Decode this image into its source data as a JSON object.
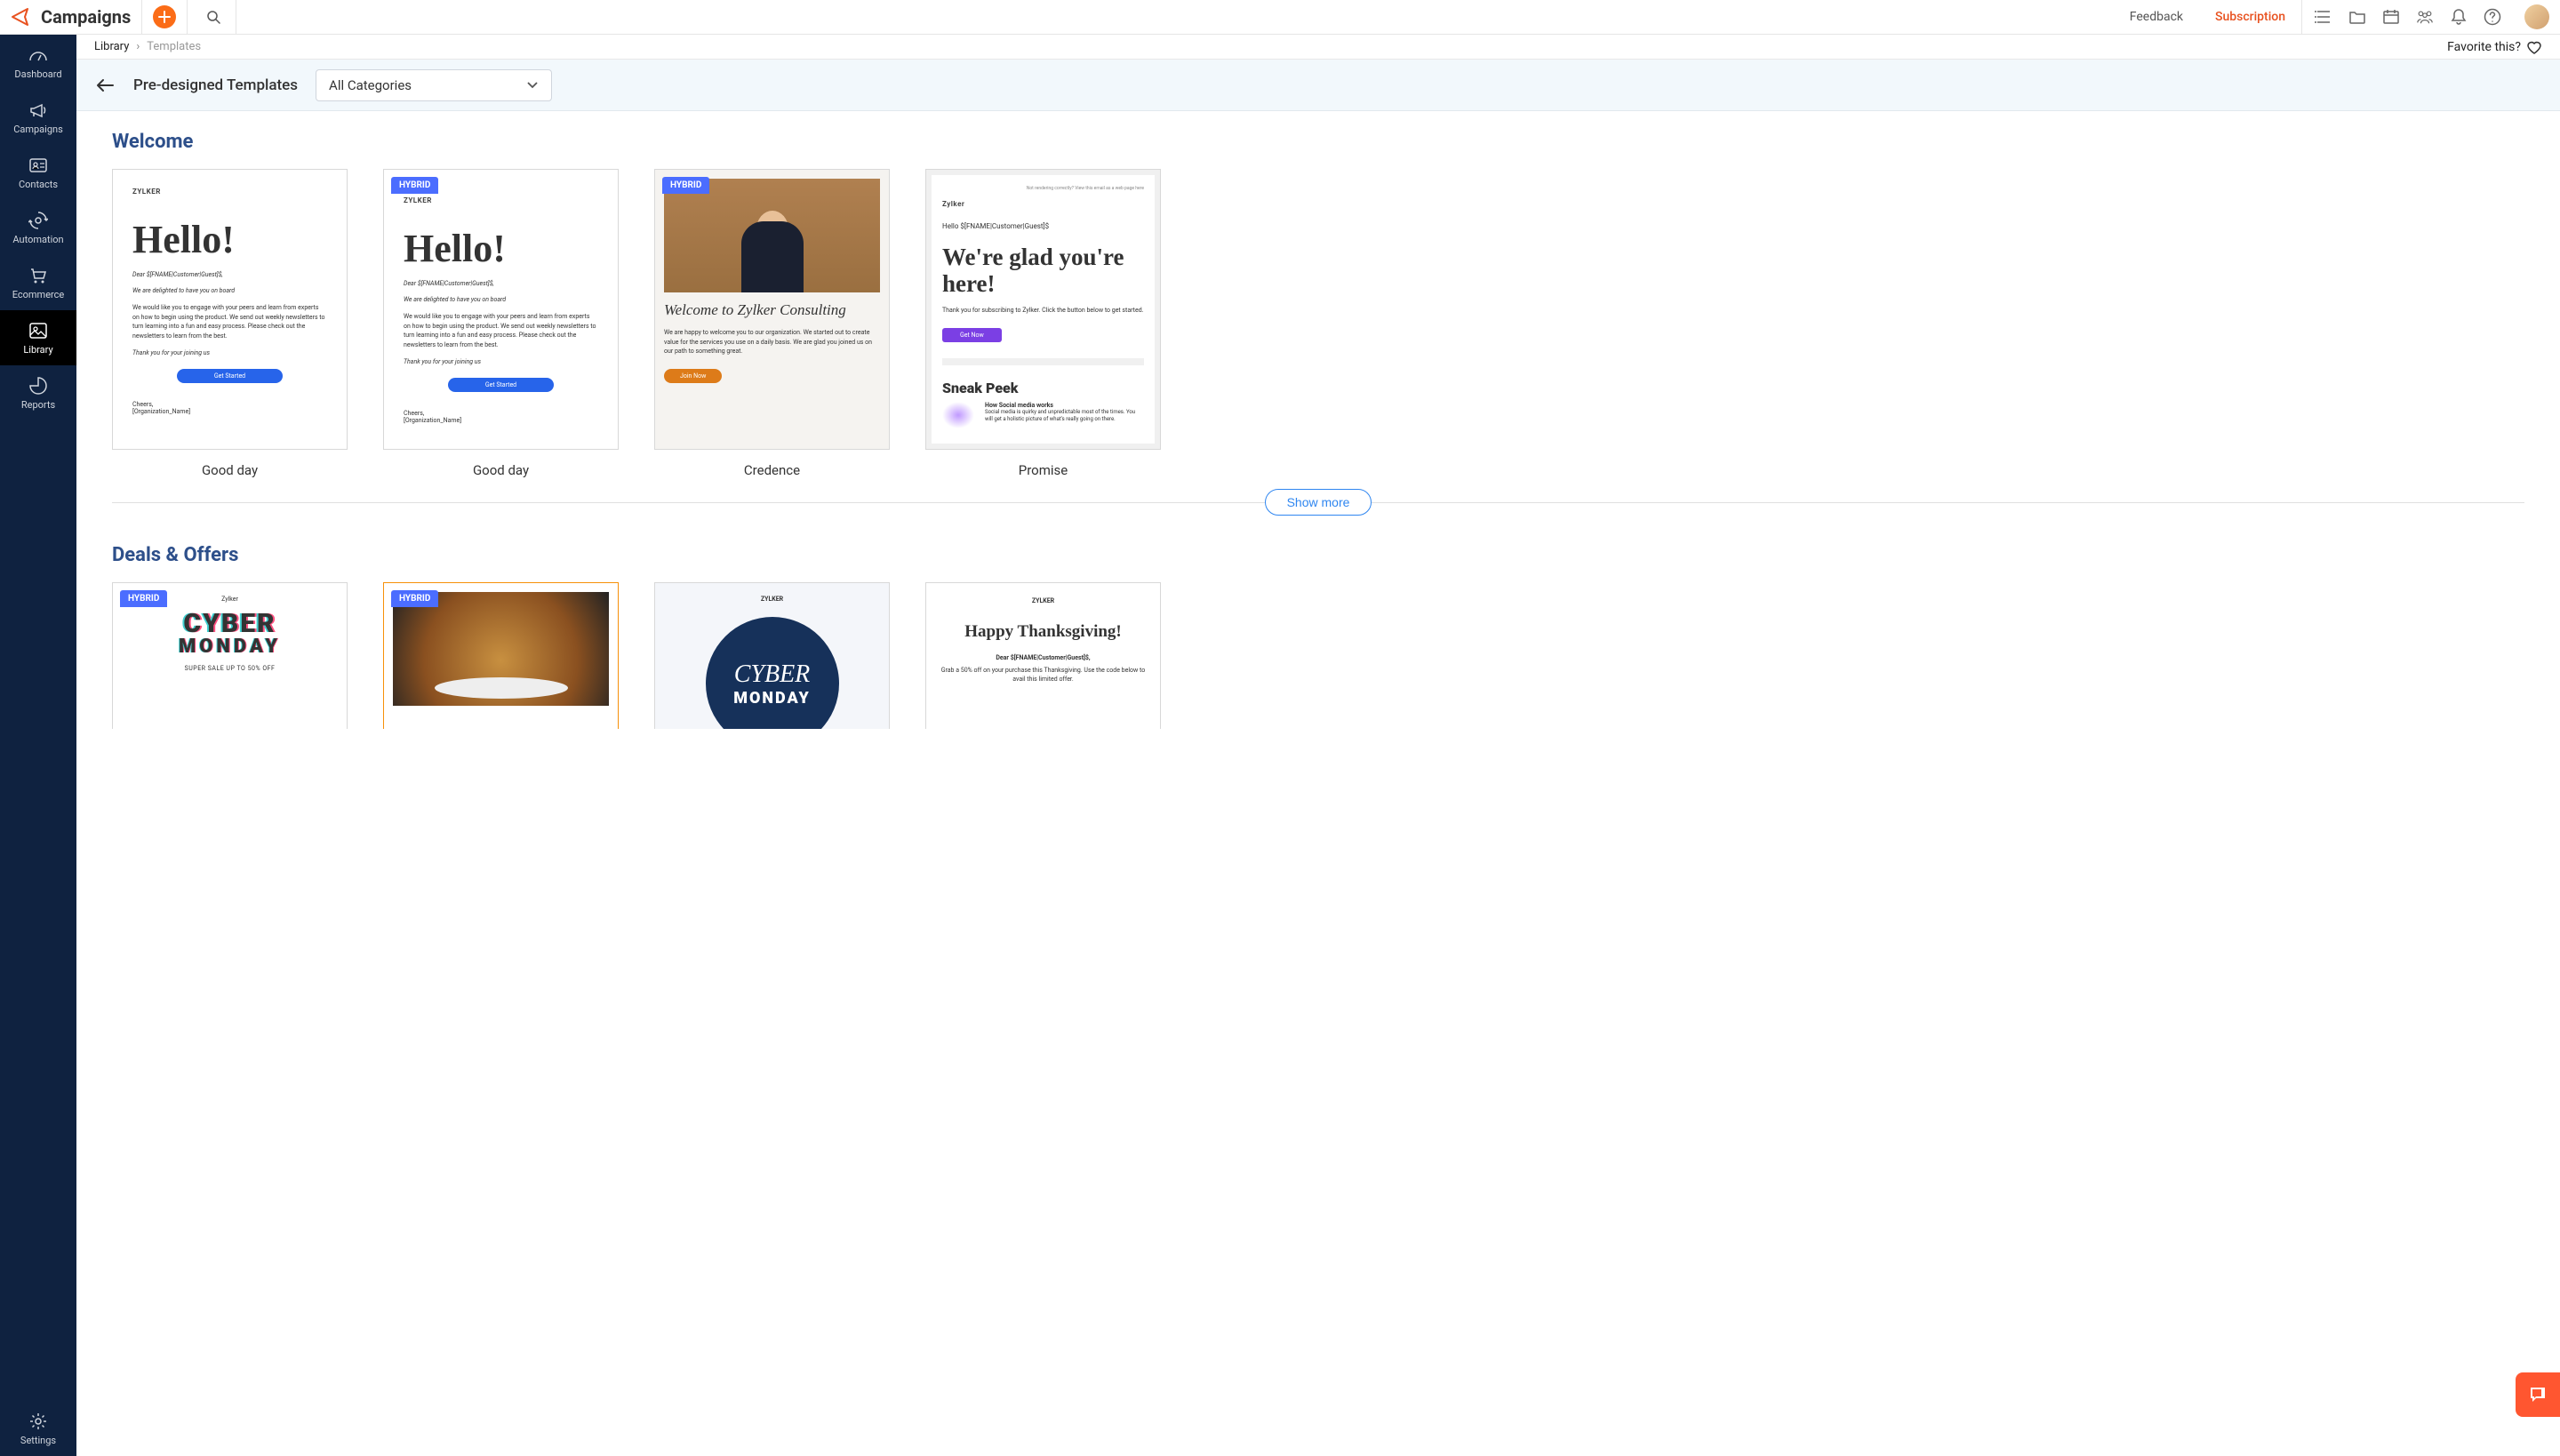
{
  "brand": {
    "title": "Campaigns"
  },
  "header": {
    "feedback": "Feedback",
    "subscription": "Subscription"
  },
  "sidebar": {
    "items": [
      {
        "label": "Dashboard"
      },
      {
        "label": "Campaigns"
      },
      {
        "label": "Contacts"
      },
      {
        "label": "Automation"
      },
      {
        "label": "Ecommerce"
      },
      {
        "label": "Library"
      },
      {
        "label": "Reports"
      }
    ],
    "settings": "Settings"
  },
  "breadcrumb": {
    "root": "Library",
    "current": "Templates",
    "favorite": "Favorite this?"
  },
  "toolbar": {
    "title": "Pre-designed Templates",
    "category": "All Categories"
  },
  "sections": [
    {
      "title": "Welcome",
      "cards": [
        {
          "name": "Good day",
          "badge": null
        },
        {
          "name": "Good day",
          "badge": "HYBRID"
        },
        {
          "name": "Credence",
          "badge": "HYBRID"
        },
        {
          "name": "Promise",
          "badge": null
        }
      ],
      "show_more": "Show more"
    },
    {
      "title": "Deals & Offers",
      "cards": [
        {
          "name": "",
          "badge": "HYBRID"
        },
        {
          "name": "",
          "badge": "HYBRID"
        },
        {
          "name": "",
          "badge": null
        },
        {
          "name": "",
          "badge": null
        }
      ]
    }
  ],
  "preview": {
    "zylker": "ZYLKER",
    "zylker2": "Zylker",
    "hello": "Hello!",
    "dear": "Dear $[FNAME|Customer|Guest]$,",
    "delighted": "We are delighted to have you on board",
    "body": "We would like you to engage with your peers and learn from experts on how to begin using the product. We send out weekly newsletters to turn learning into a fun and easy process. Please check out the newsletters to learn from the best.",
    "thank": "Thank you for your joining us",
    "get_started": "Get Started",
    "cheers": "Cheers,",
    "org": "[Organization_Name]",
    "credence_title": "Welcome to Zylker Consulting",
    "credence_body": "We are happy to welcome you to our organization. We started out to create value for the services you use on a daily basis. We are glad you joined us on our path to something great.",
    "join_now": "Join Now",
    "promise_top": "Not rendering correctly? View this email as a web page here",
    "promise_hello": "Hello $[FNAME|Customer|Guest]$",
    "glad": "We're glad you're here!",
    "promise_body": "Thank you for subscribing to Zylker. Click the button below to get started.",
    "get_now": "Get Now",
    "sneak": "Sneak Peek",
    "sneak_h": "How Social media works",
    "sneak_b": "Social media is quirky and unpredictable most of the times. You will get a holistic picture of what's really going on there.",
    "cyber": "CYBER",
    "monday": "MONDAY",
    "super_sale": "SUPER SALE UP TO 50% OFF",
    "happy_thanks": "Happy Thanksgiving!",
    "thanks_body": "Grab a 50% off on your purchase this Thanksgiving. Use the code below to avail this limited offer."
  }
}
